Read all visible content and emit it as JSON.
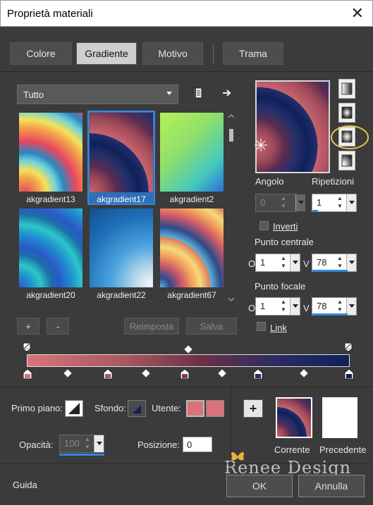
{
  "window": {
    "title": "Proprietà materiali",
    "close": "✕"
  },
  "tabs": [
    "Colore",
    "Gradiente",
    "Motivo",
    "Trama"
  ],
  "gallery": {
    "filter": "Tutto",
    "items": [
      {
        "name": "akgradient13",
        "selected": false
      },
      {
        "name": "akgradient17",
        "selected": true
      },
      {
        "name": "akgradient2",
        "selected": false
      },
      {
        "name": "akgradient20",
        "selected": false
      },
      {
        "name": "akgradient22",
        "selected": false
      },
      {
        "name": "akgradient67",
        "selected": false
      }
    ]
  },
  "buttons": {
    "add": "+",
    "remove": "-",
    "reset": "Reimposta",
    "save": "Salva",
    "ok": "OK",
    "cancel": "Annulla",
    "help": "Guida"
  },
  "controls": {
    "angle_label": "Angolo",
    "angle_value": "0",
    "repeat_label": "Ripetizioni",
    "repeat_value": "1",
    "invert_label": "Inverti",
    "center_label": "Punto centrale",
    "center_o": "1",
    "center_v": "78",
    "focal_label": "Punto focale",
    "focal_o": "1",
    "focal_v": "78",
    "link_label": "Link",
    "o_label": "O",
    "v_label": "V"
  },
  "bottom": {
    "foreground_label": "Primo piano:",
    "background_label": "Sfondo:",
    "user_label": "Utente:",
    "opacity_label": "Opacità:",
    "opacity_value": "100",
    "position_label": "Posizione:",
    "position_value": "0",
    "current_label": "Corrente",
    "previous_label": "Precedente",
    "watermark": "Renee Design"
  },
  "colors": {
    "accent": "#2f86e0",
    "stop_pink": "#d9737a",
    "stop_navy": "#10205a",
    "highlight_ring": "#e6c34a"
  }
}
